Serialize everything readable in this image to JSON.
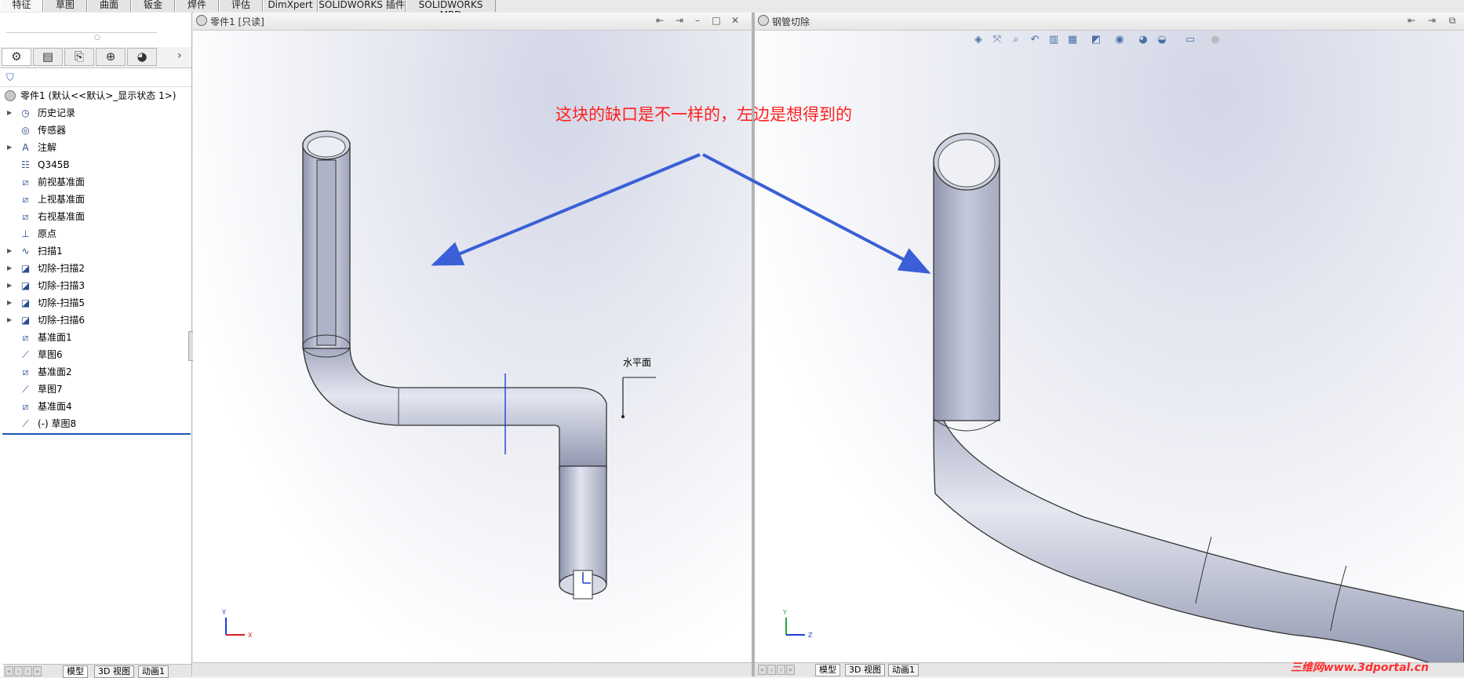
{
  "top_tabs": [
    "特征",
    "草图",
    "曲面",
    "钣金",
    "焊件",
    "评估",
    "DimXpert",
    "SOLIDWORKS 插件",
    "SOLIDWORKS MBD"
  ],
  "left_window": {
    "title": "零件1 [只读]",
    "bottom_tabs": [
      "模型",
      "3D 视图",
      "动画1"
    ],
    "dimension_label": "水平面"
  },
  "right_window": {
    "title": "钢管切除",
    "bottom_tabs": [
      "模型",
      "3D 视图",
      "动画1"
    ]
  },
  "feature_tree": {
    "root": "零件1  (默认<<默认>_显示状态 1>)",
    "items": [
      {
        "label": "历史记录",
        "icon": "history-icon",
        "expandable": true
      },
      {
        "label": "传感器",
        "icon": "sensor-icon",
        "expandable": false
      },
      {
        "label": "注解",
        "icon": "annotation-icon",
        "expandable": true
      },
      {
        "label": "Q345B",
        "icon": "material-icon",
        "expandable": false
      },
      {
        "label": "前视基准面",
        "icon": "plane-icon",
        "expandable": false
      },
      {
        "label": "上视基准面",
        "icon": "plane-icon",
        "expandable": false
      },
      {
        "label": "右视基准面",
        "icon": "plane-icon",
        "expandable": false
      },
      {
        "label": "原点",
        "icon": "origin-icon",
        "expandable": false
      },
      {
        "label": "扫描1",
        "icon": "sweep-icon",
        "expandable": true
      },
      {
        "label": "切除-扫描2",
        "icon": "cut-sweep-icon",
        "expandable": true
      },
      {
        "label": "切除-扫描3",
        "icon": "cut-sweep-icon",
        "expandable": true
      },
      {
        "label": "切除-扫描5",
        "icon": "cut-sweep-icon",
        "expandable": true
      },
      {
        "label": "切除-扫描6",
        "icon": "cut-sweep-icon",
        "expandable": true
      },
      {
        "label": "基准面1",
        "icon": "plane-icon",
        "expandable": false
      },
      {
        "label": "草图6",
        "icon": "sketch-icon",
        "expandable": false
      },
      {
        "label": "基准面2",
        "icon": "plane-icon",
        "expandable": false
      },
      {
        "label": "草图7",
        "icon": "sketch-icon",
        "expandable": false
      },
      {
        "label": "基准面4",
        "icon": "plane-icon",
        "expandable": false
      },
      {
        "label": "(-) 草图8",
        "icon": "sketch-icon",
        "expandable": false
      }
    ]
  },
  "annotation": "这块的缺口是不一样的，左边是想得到的",
  "watermark": "三维网www.3dportal.cn",
  "axes": {
    "left": [
      "Y",
      "X"
    ],
    "right": [
      "Y",
      "Z"
    ]
  },
  "colors": {
    "arrow": "#3a5fd6",
    "annotation": "#ff1f1f",
    "tube": "#b3b8cc"
  }
}
